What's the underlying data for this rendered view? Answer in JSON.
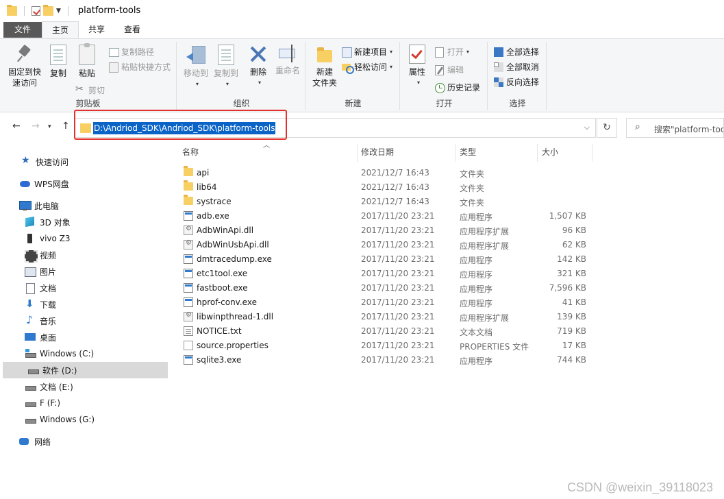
{
  "window": {
    "title": "platform-tools"
  },
  "tabs": [
    {
      "label": "文件"
    },
    {
      "label": "主页"
    },
    {
      "label": "共享"
    },
    {
      "label": "查看"
    }
  ],
  "ribbon": {
    "clipboard": {
      "label": "剪贴板",
      "pin_line1": "固定到快",
      "pin_line2": "速访问",
      "copy": "复制",
      "paste": "粘贴",
      "copy_path": "复制路径",
      "paste_shortcut": "粘贴快捷方式",
      "cut": "剪切"
    },
    "organize": {
      "label": "组织",
      "move_to": "移动到",
      "copy_to": "复制到",
      "delete": "删除",
      "rename": "重命名"
    },
    "new": {
      "label": "新建",
      "new_folder_line1": "新建",
      "new_folder_line2": "文件夹",
      "new_item": "新建项目",
      "easy_access": "轻松访问"
    },
    "open": {
      "label": "打开",
      "properties": "属性",
      "open": "打开",
      "edit": "编辑",
      "history": "历史记录"
    },
    "select": {
      "label": "选择",
      "select_all": "全部选择",
      "select_none": "全部取消",
      "invert": "反向选择"
    }
  },
  "address": {
    "path": "D:\\Andriod_SDK\\Andriod_SDK\\platform-tools",
    "search_placeholder": "搜索\"platform-tools\""
  },
  "sidebar": {
    "items": [
      {
        "label": "快速访问"
      },
      {
        "label": "WPS网盘"
      },
      {
        "label": "此电脑"
      },
      {
        "label": "3D 对象"
      },
      {
        "label": "vivo Z3"
      },
      {
        "label": "视频"
      },
      {
        "label": "图片"
      },
      {
        "label": "文档"
      },
      {
        "label": "下载"
      },
      {
        "label": "音乐"
      },
      {
        "label": "桌面"
      },
      {
        "label": "Windows (C:)"
      },
      {
        "label": "软件 (D:)"
      },
      {
        "label": "文档 (E:)"
      },
      {
        "label": "F (F:)"
      },
      {
        "label": "Windows (G:)"
      },
      {
        "label": "网络"
      }
    ]
  },
  "columns": {
    "name": "名称",
    "date": "修改日期",
    "type": "类型",
    "size": "大小"
  },
  "files": [
    {
      "name": "api",
      "date": "2021/12/7 16:43",
      "type": "文件夹",
      "size": ""
    },
    {
      "name": "lib64",
      "date": "2021/12/7 16:43",
      "type": "文件夹",
      "size": ""
    },
    {
      "name": "systrace",
      "date": "2021/12/7 16:43",
      "type": "文件夹",
      "size": ""
    },
    {
      "name": "adb.exe",
      "date": "2017/11/20 23:21",
      "type": "应用程序",
      "size": "1,507 KB"
    },
    {
      "name": "AdbWinApi.dll",
      "date": "2017/11/20 23:21",
      "type": "应用程序扩展",
      "size": "96 KB"
    },
    {
      "name": "AdbWinUsbApi.dll",
      "date": "2017/11/20 23:21",
      "type": "应用程序扩展",
      "size": "62 KB"
    },
    {
      "name": "dmtracedump.exe",
      "date": "2017/11/20 23:21",
      "type": "应用程序",
      "size": "142 KB"
    },
    {
      "name": "etc1tool.exe",
      "date": "2017/11/20 23:21",
      "type": "应用程序",
      "size": "321 KB"
    },
    {
      "name": "fastboot.exe",
      "date": "2017/11/20 23:21",
      "type": "应用程序",
      "size": "7,596 KB"
    },
    {
      "name": "hprof-conv.exe",
      "date": "2017/11/20 23:21",
      "type": "应用程序",
      "size": "41 KB"
    },
    {
      "name": "libwinpthread-1.dll",
      "date": "2017/11/20 23:21",
      "type": "应用程序扩展",
      "size": "139 KB"
    },
    {
      "name": "NOTICE.txt",
      "date": "2017/11/20 23:21",
      "type": "文本文档",
      "size": "719 KB"
    },
    {
      "name": "source.properties",
      "date": "2017/11/20 23:21",
      "type": "PROPERTIES 文件",
      "size": "17 KB"
    },
    {
      "name": "sqlite3.exe",
      "date": "2017/11/20 23:21",
      "type": "应用程序",
      "size": "744 KB"
    }
  ],
  "watermark": "CSDN @weixin_39118023",
  "colors": {
    "accent": "#0a64c8",
    "highlight_box": "#e3312b",
    "file_tab": "#595959"
  }
}
